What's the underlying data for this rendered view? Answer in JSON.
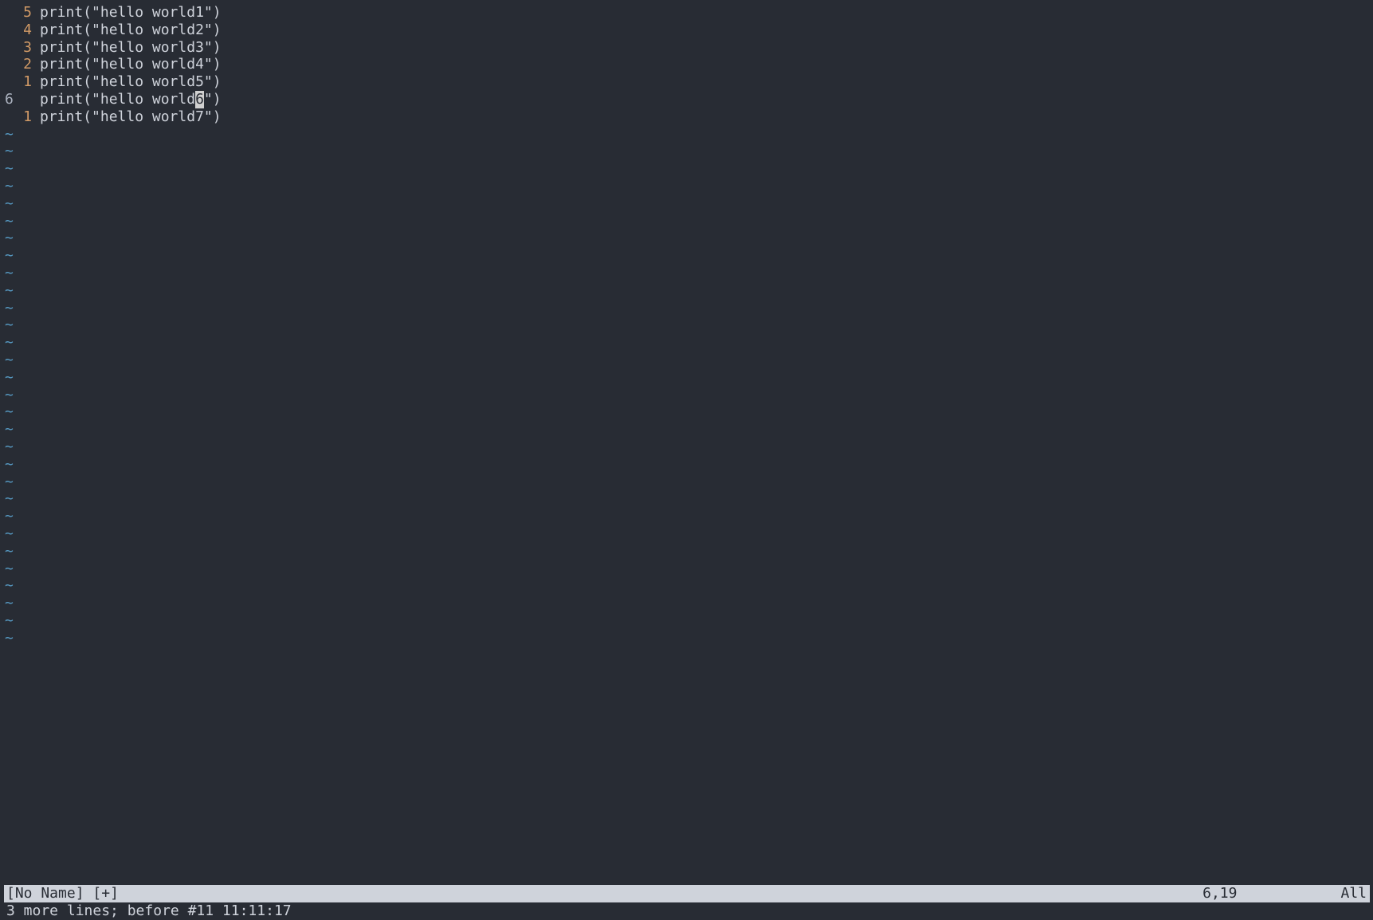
{
  "editor": {
    "lines": [
      {
        "number": "5",
        "content": "print(\"hello world1\")"
      },
      {
        "number": "4",
        "content": "print(\"hello world2\")"
      },
      {
        "number": "3",
        "content": "print(\"hello world3\")"
      },
      {
        "number": "2",
        "content": "print(\"hello world4\")"
      },
      {
        "number": "1",
        "content": "print(\"hello world5\")"
      }
    ],
    "current_line": {
      "number": "6",
      "before_cursor": "print(\"hello world",
      "cursor_char": "6",
      "after_cursor": "\")"
    },
    "lines_after": [
      {
        "number": "1",
        "content": "print(\"hello world7\")"
      }
    ],
    "tilde": "~",
    "tilde_count": 30
  },
  "status": {
    "filename": "[No Name]",
    "modified": "[+]",
    "position": "6,19",
    "scroll": "All"
  },
  "message": "3 more lines; before #11  11:11:17"
}
